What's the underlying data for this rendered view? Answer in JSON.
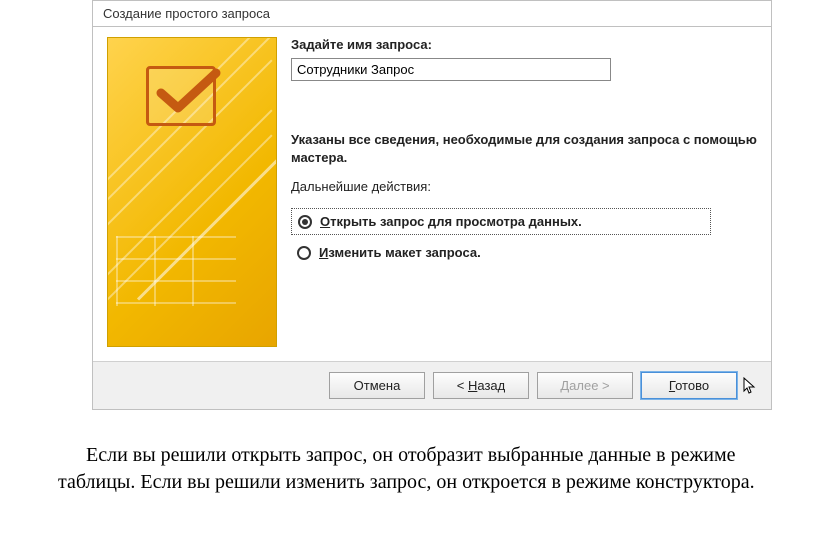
{
  "dialog": {
    "title": "Создание простого запроса",
    "name_label": "Задайте имя запроса:",
    "name_value": "Сотрудники Запрос",
    "info": "Указаны все сведения, необходимые для создания запроса с помощью мастера.",
    "next_actions": "Дальнейшие действия:",
    "options": {
      "open_prefix": "О",
      "open_rest": "ткрыть запрос для просмотра данных.",
      "modify_prefix": "И",
      "modify_rest": "зменить макет запроса."
    },
    "buttons": {
      "cancel": "Отмена",
      "back_prefix": "< ",
      "back_ul": "Н",
      "back_rest": "азад",
      "next_ul": "Д",
      "next_rest": "алее >",
      "finish_ul": "Г",
      "finish_rest": "отово"
    }
  },
  "caption": "Если вы решили открыть запрос, он отобразит выбранные данные в режиме таблицы. Если вы решили изменить запрос, он откроется в режиме конструктора."
}
